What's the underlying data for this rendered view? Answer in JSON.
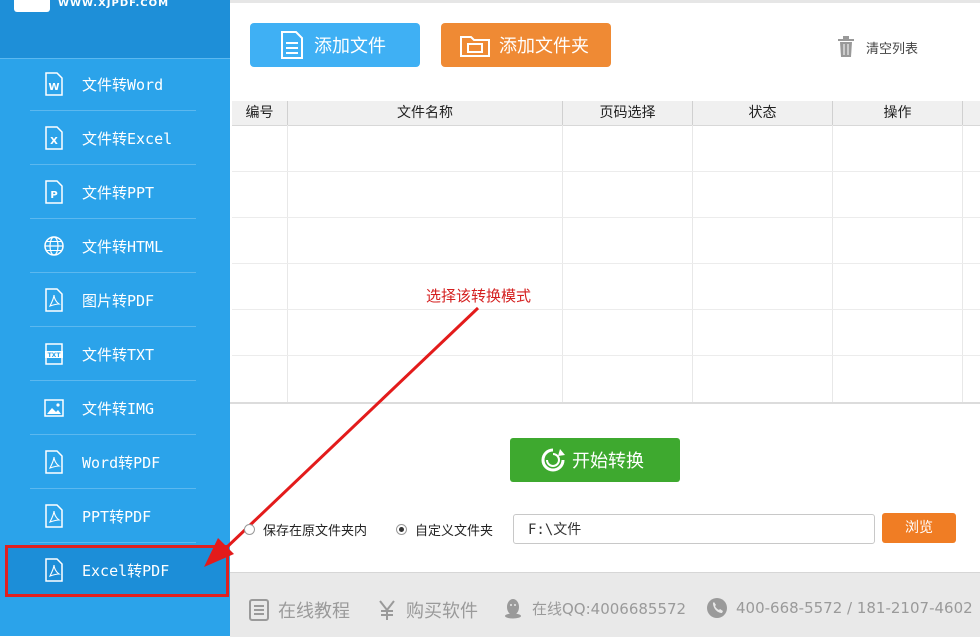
{
  "header": {
    "url": "WWW.XJPDF.COM"
  },
  "sidebar": {
    "items": [
      {
        "label": "文件转Word",
        "icon": "word-doc-icon"
      },
      {
        "label": "文件转Excel",
        "icon": "excel-doc-icon"
      },
      {
        "label": "文件转PPT",
        "icon": "ppt-doc-icon"
      },
      {
        "label": "文件转HTML",
        "icon": "globe-icon"
      },
      {
        "label": "图片转PDF",
        "icon": "pdf-doc-icon"
      },
      {
        "label": "文件转TXT",
        "icon": "txt-doc-icon"
      },
      {
        "label": "文件转IMG",
        "icon": "image-icon"
      },
      {
        "label": "Word转PDF",
        "icon": "pdf-doc-icon"
      },
      {
        "label": "PPT转PDF",
        "icon": "pdf-doc-icon"
      },
      {
        "label": "Excel转PDF",
        "icon": "pdf-doc-icon"
      }
    ],
    "active_index": 9
  },
  "toolbar": {
    "add_file": "添加文件",
    "add_folder": "添加文件夹",
    "clear_list": "清空列表"
  },
  "table": {
    "columns": [
      "编号",
      "文件名称",
      "页码选择",
      "状态",
      "操作"
    ],
    "rows": []
  },
  "annotation": "选择该转换模式",
  "actions": {
    "start": "开始转换"
  },
  "output": {
    "option_original": "保存在原文件夹内",
    "option_custom": "自定义文件夹",
    "selected": "custom",
    "path": "F:\\文件",
    "browse": "浏览"
  },
  "footer": {
    "tutorial": "在线教程",
    "buy": "购买软件",
    "qq": "在线QQ:4006685572",
    "phone": "400-668-5572 / 181-2107-4602"
  },
  "colors": {
    "sidebar": "#2ba3ea",
    "add_file": "#3fb0f4",
    "add_folder": "#ef8a34",
    "start": "#3ea92f",
    "browse": "#f07d24",
    "annotation": "#d41f1f"
  }
}
